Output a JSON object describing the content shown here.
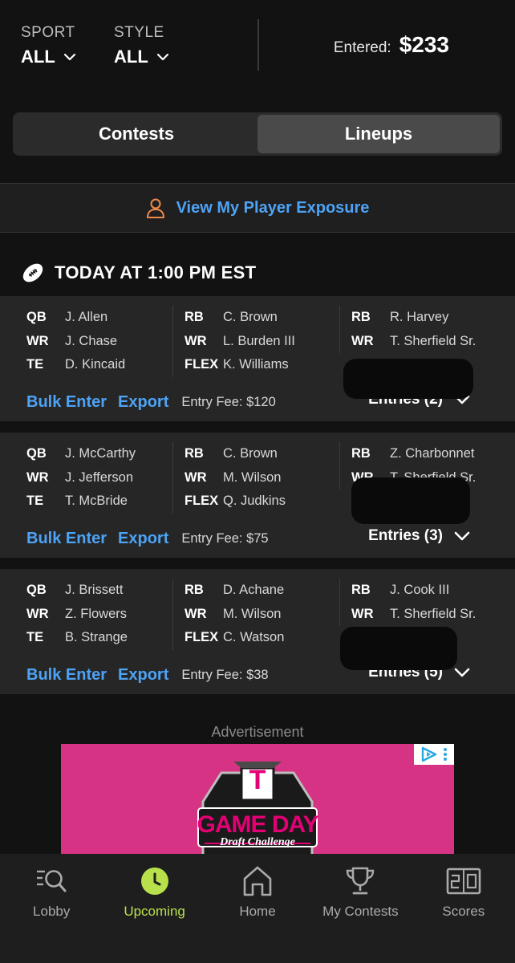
{
  "filters": {
    "sport_label": "SPORT",
    "sport_value": "ALL",
    "style_label": "STYLE",
    "style_value": "ALL"
  },
  "entered": {
    "label": "Entered:",
    "amount": "$233"
  },
  "tabs": [
    {
      "label": "Contests",
      "active": false
    },
    {
      "label": "Lineups",
      "active": true
    }
  ],
  "exposure": {
    "label": "View My Player Exposure"
  },
  "section": {
    "title": "TODAY AT 1:00 PM EST"
  },
  "lineups": [
    {
      "col1": [
        [
          "QB",
          "J. Allen"
        ],
        [
          "WR",
          "J. Chase"
        ],
        [
          "TE",
          "D. Kincaid"
        ]
      ],
      "col2": [
        [
          "RB",
          "C. Brown"
        ],
        [
          "WR",
          "L. Burden III"
        ],
        [
          "FLEX",
          "K. Williams"
        ]
      ],
      "col3": [
        [
          "RB",
          "R. Harvey"
        ],
        [
          "WR",
          "T. Sherfield Sr."
        ]
      ],
      "bulk": "Bulk Enter",
      "export": "Export",
      "fee": "Entry Fee: $120",
      "entries": "Entries (2)"
    },
    {
      "col1": [
        [
          "QB",
          "J. McCarthy"
        ],
        [
          "WR",
          "J. Jefferson"
        ],
        [
          "TE",
          "T. McBride"
        ]
      ],
      "col2": [
        [
          "RB",
          "C. Brown"
        ],
        [
          "WR",
          "M. Wilson"
        ],
        [
          "FLEX",
          "Q. Judkins"
        ]
      ],
      "col3": [
        [
          "RB",
          "Z. Charbonnet"
        ],
        [
          "WR",
          "T. Sherfield Sr."
        ]
      ],
      "bulk": "Bulk Enter",
      "export": "Export",
      "fee": "Entry Fee: $75",
      "entries": "Entries (3)"
    },
    {
      "col1": [
        [
          "QB",
          "J. Brissett"
        ],
        [
          "WR",
          "Z. Flowers"
        ],
        [
          "TE",
          "B. Strange"
        ]
      ],
      "col2": [
        [
          "RB",
          "D. Achane"
        ],
        [
          "WR",
          "M. Wilson"
        ],
        [
          "FLEX",
          "C. Watson"
        ]
      ],
      "col3": [
        [
          "RB",
          "J. Cook III"
        ],
        [
          "WR",
          "T. Sherfield Sr."
        ]
      ],
      "bulk": "Bulk Enter",
      "export": "Export",
      "fee": "Entry Fee: $38",
      "entries": "Entries (5)"
    }
  ],
  "ad": {
    "label": "Advertisement",
    "headline": "GAME DAY",
    "subline": "Draft Challenge",
    "brand": "T"
  },
  "nav": [
    {
      "label": "Lobby",
      "icon": "lobby-search-icon"
    },
    {
      "label": "Upcoming",
      "icon": "clock-icon",
      "active": true
    },
    {
      "label": "Home",
      "icon": "home-icon"
    },
    {
      "label": "My Contests",
      "icon": "trophy-icon"
    },
    {
      "label": "Scores",
      "icon": "scoreboard-icon"
    }
  ],
  "colors": {
    "accent_blue": "#4da3f5",
    "accent_green": "#b8e04a",
    "ad_pink": "#d63384",
    "person_orange": "#f08a4b"
  }
}
